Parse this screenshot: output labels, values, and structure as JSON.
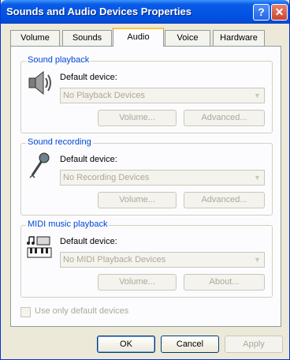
{
  "window": {
    "title": "Sounds and Audio Devices Properties",
    "help_glyph": "?",
    "close_glyph": "✕"
  },
  "tabs": [
    {
      "label": "Volume"
    },
    {
      "label": "Sounds"
    },
    {
      "label": "Audio",
      "active": true
    },
    {
      "label": "Voice"
    },
    {
      "label": "Hardware"
    }
  ],
  "playback": {
    "title": "Sound playback",
    "device_label": "Default device:",
    "device_value": "No Playback Devices",
    "volume_button": "Volume...",
    "advanced_button": "Advanced..."
  },
  "recording": {
    "title": "Sound recording",
    "device_label": "Default device:",
    "device_value": "No Recording Devices",
    "volume_button": "Volume...",
    "advanced_button": "Advanced..."
  },
  "midi": {
    "title": "MIDI music playback",
    "device_label": "Default device:",
    "device_value": "No MIDI Playback Devices",
    "volume_button": "Volume...",
    "about_button": "About..."
  },
  "use_default_only": {
    "label": "Use only default devices",
    "checked": false,
    "disabled": true
  },
  "buttons": {
    "ok": "OK",
    "cancel": "Cancel",
    "apply": "Apply"
  },
  "icons": {
    "playback": "speaker-icon",
    "recording": "microphone-icon",
    "midi": "midi-keyboard-icon",
    "dropdown": "dropdown-arrow-icon"
  }
}
